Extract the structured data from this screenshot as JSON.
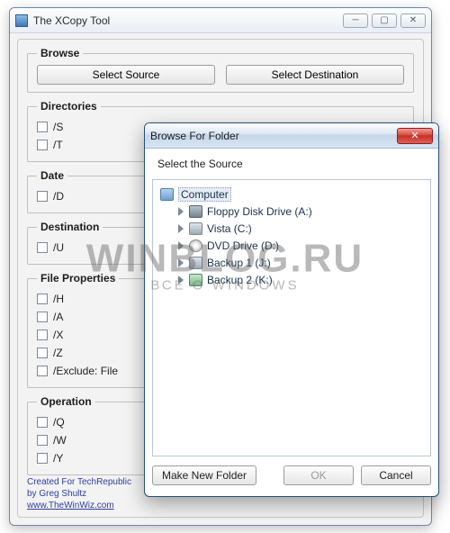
{
  "window": {
    "title": "The XCopy Tool",
    "minimize_glyph": "─",
    "maximize_glyph": "▢",
    "close_glyph": "✕"
  },
  "sections": {
    "browse": {
      "legend": "Browse",
      "select_source": "Select Source",
      "select_destination": "Select Destination"
    },
    "directories": {
      "legend": "Directories",
      "opts": [
        "/S",
        "/T"
      ]
    },
    "date": {
      "legend": "Date",
      "opts": [
        "/D"
      ]
    },
    "destination": {
      "legend": "Destination",
      "opts": [
        "/U"
      ]
    },
    "file_properties": {
      "legend": "File Properties",
      "opts": [
        "/H",
        "/A",
        "/X",
        "/Z",
        "/Exclude: File"
      ]
    },
    "operation": {
      "legend": "Operation",
      "opts": [
        "/Q",
        "/W",
        "/Y"
      ]
    }
  },
  "footer": {
    "line1": "Created For TechRepublic",
    "line2": "by Greg Shultz",
    "link": "www.TheWinWiz.com"
  },
  "dialog": {
    "title": "Browse For Folder",
    "close_glyph": "✕",
    "prompt": "Select the Source",
    "tree": {
      "root": "Computer",
      "items": [
        "Floppy Disk Drive (A:)",
        "Vista (C:)",
        "DVD Drive (D:)",
        "Backup 1 (J:)",
        "Backup 2 (K:)"
      ]
    },
    "buttons": {
      "make_new_folder": "Make New Folder",
      "ok": "OK",
      "cancel": "Cancel"
    }
  },
  "watermark": {
    "big": "WINBLOG.RU",
    "small": "ВСЁ О WINDOWS"
  }
}
